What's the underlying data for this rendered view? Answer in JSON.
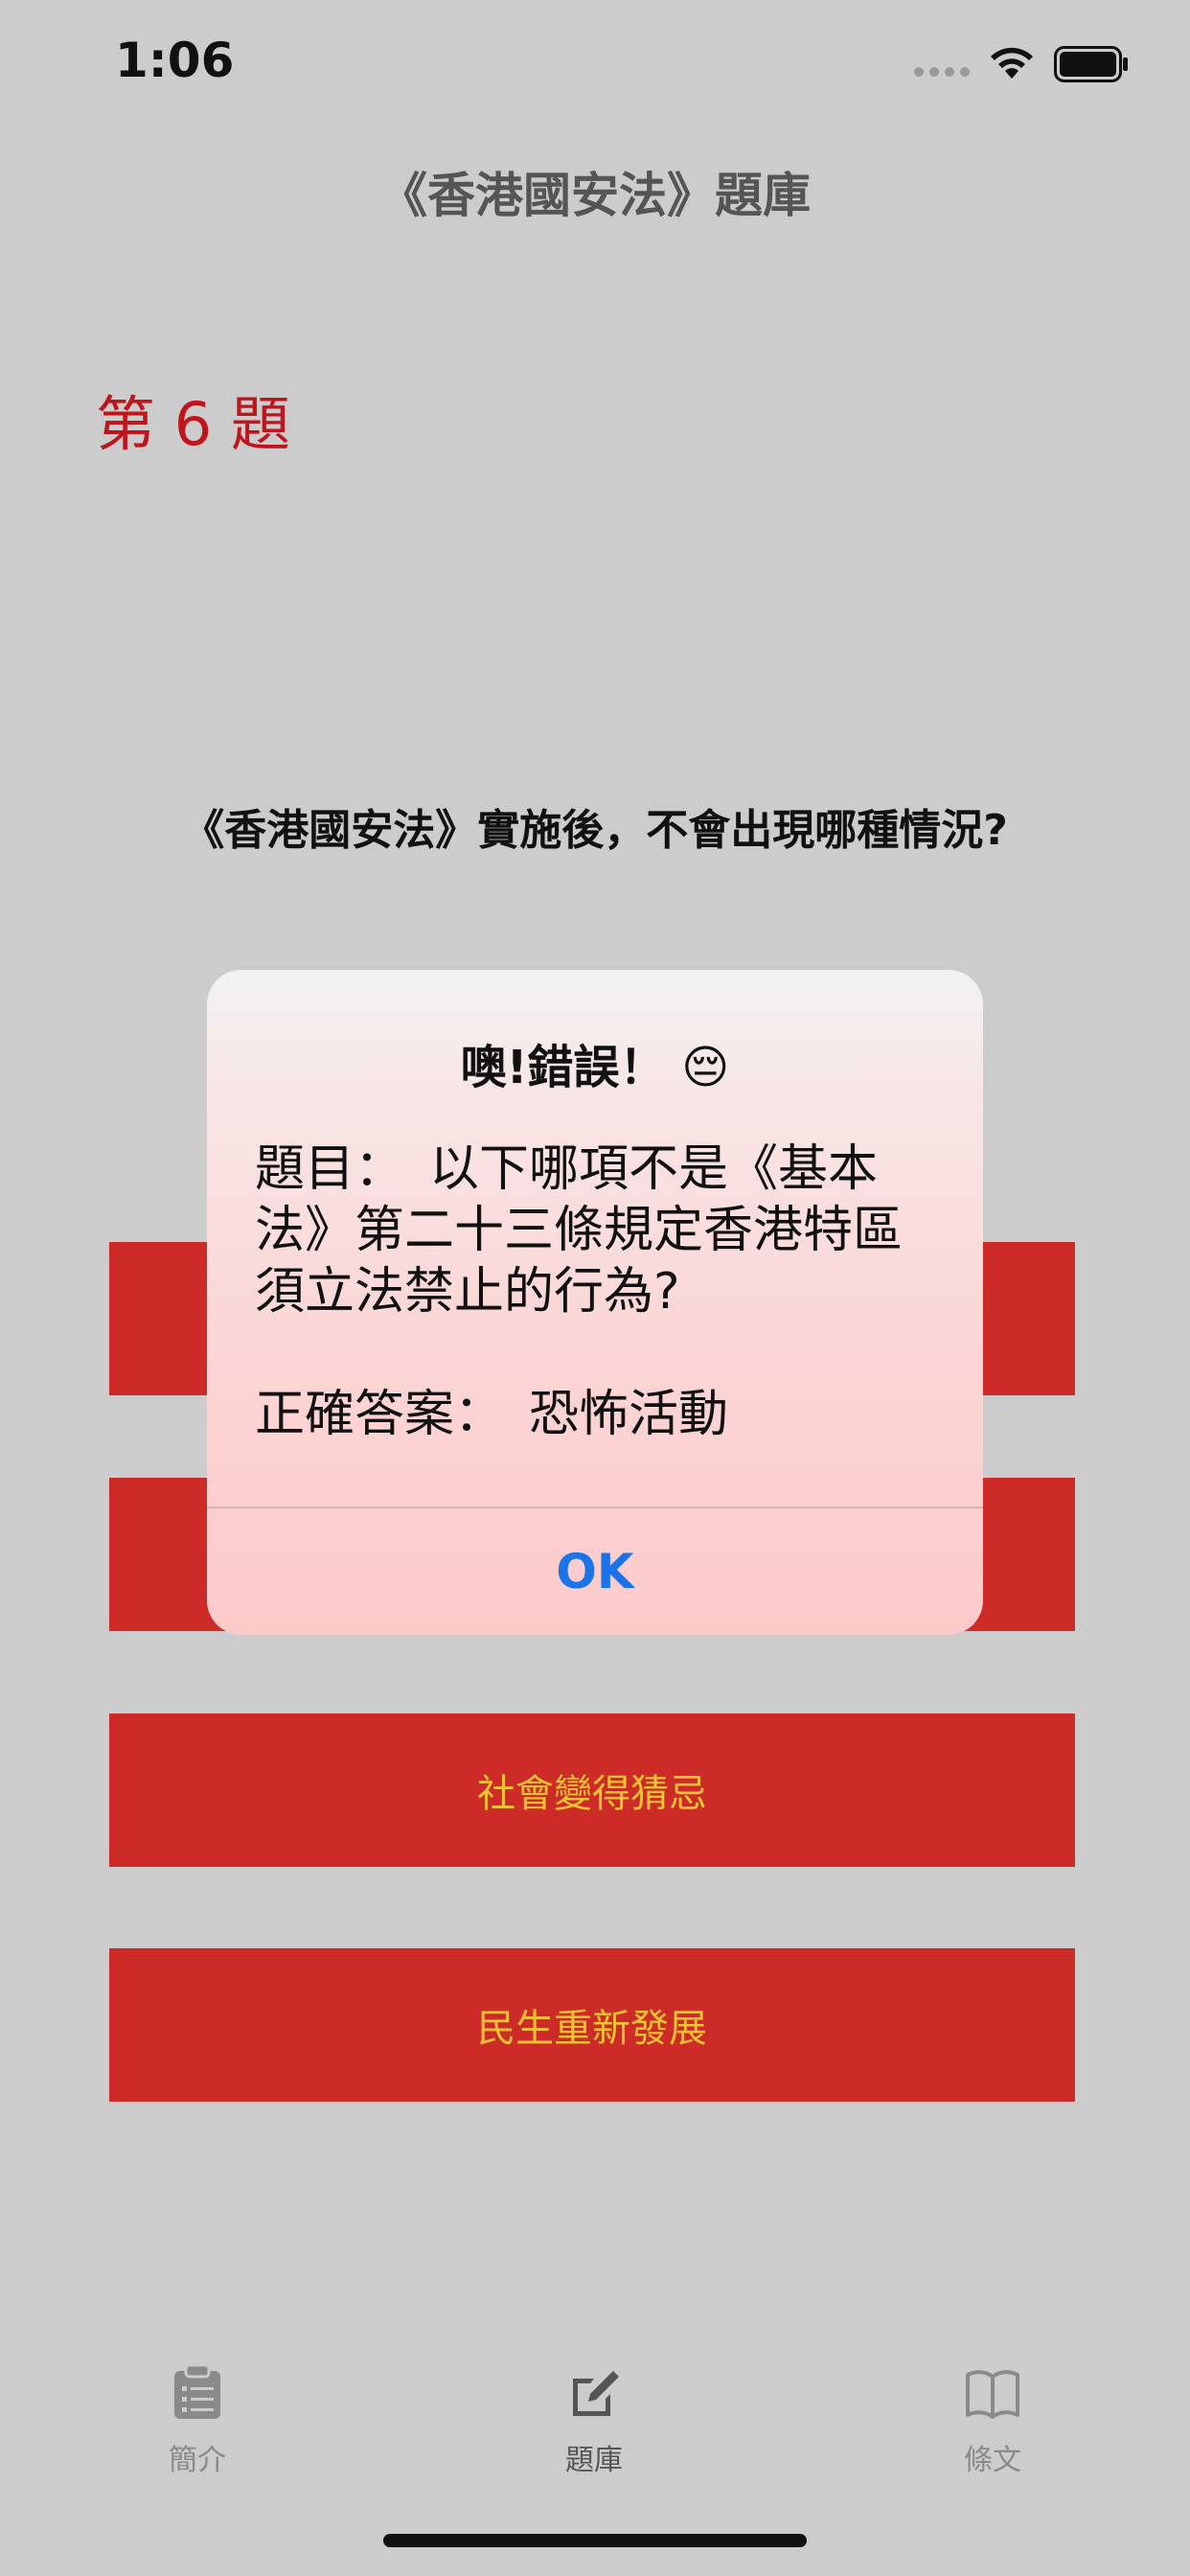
{
  "status_bar": {
    "time": "1:06"
  },
  "nav": {
    "title": "《香港國安法》題庫"
  },
  "question": {
    "number_label": "第 6 題",
    "text": "《香港國安法》實施後，不會出現哪種情況?"
  },
  "answers": [
    {
      "label": ""
    },
    {
      "label": ""
    },
    {
      "label": "社會變得猜忌"
    },
    {
      "label": "民生重新發展"
    }
  ],
  "alert": {
    "title": "噢!錯誤！",
    "emoji": "😔",
    "question_line": "題目：　以下哪項不是《基本法》第二十三條規定香港特區須立法禁止的行為?",
    "answer_line": "正確答案：　恐怖活動",
    "ok_label": "OK"
  },
  "tab_bar": {
    "items": [
      {
        "label": "簡介",
        "icon": "clipboard-icon",
        "active": false
      },
      {
        "label": "題庫",
        "icon": "compose-icon",
        "active": true
      },
      {
        "label": "條文",
        "icon": "book-icon",
        "active": false
      }
    ]
  },
  "colors": {
    "background": "#cccccc",
    "accent_red": "#c0151d",
    "button_red": "#cd2b27",
    "button_text": "#f1c232",
    "link_blue": "#1a73e8"
  }
}
